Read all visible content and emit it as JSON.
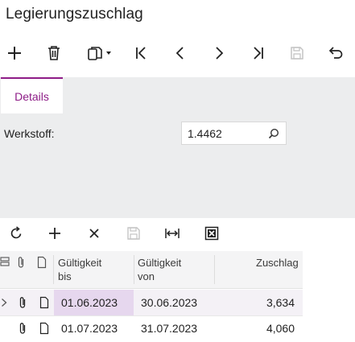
{
  "window": {
    "title": "Legierungszuschlag"
  },
  "toolbar": {
    "icons": [
      "add-icon",
      "delete-icon",
      "copy-icon",
      "first-record-icon",
      "previous-record-icon",
      "next-record-icon",
      "last-record-icon",
      "save-icon",
      "undo-icon"
    ]
  },
  "tabs": [
    {
      "label": "Details",
      "active": true
    }
  ],
  "form": {
    "werkstoff_label": "Werkstoff:",
    "werkstoff_value": "1.4462"
  },
  "grid_toolbar": {
    "icons": [
      "refresh-icon",
      "add-icon",
      "remove-icon",
      "save-icon",
      "fit-columns-icon",
      "excel-export-icon"
    ]
  },
  "grid": {
    "columns": [
      {
        "line1": "Gültigkeit",
        "line2": "bis"
      },
      {
        "line1": "Gültigkeit",
        "line2": "von"
      },
      {
        "line1": "Zuschlag",
        "line2": ""
      }
    ],
    "rows": [
      {
        "bis": "01.06.2023",
        "von": "30.06.2023",
        "zuschlag": "3,634",
        "selected": true
      },
      {
        "bis": "01.07.2023",
        "von": "31.07.2023",
        "zuschlag": "4,060",
        "selected": false
      }
    ]
  },
  "colors": {
    "accent": "#8e1c87",
    "panel": "#ecedee",
    "selected_row": "#f4f1f6",
    "selected_cell": "#e6d7ee"
  }
}
